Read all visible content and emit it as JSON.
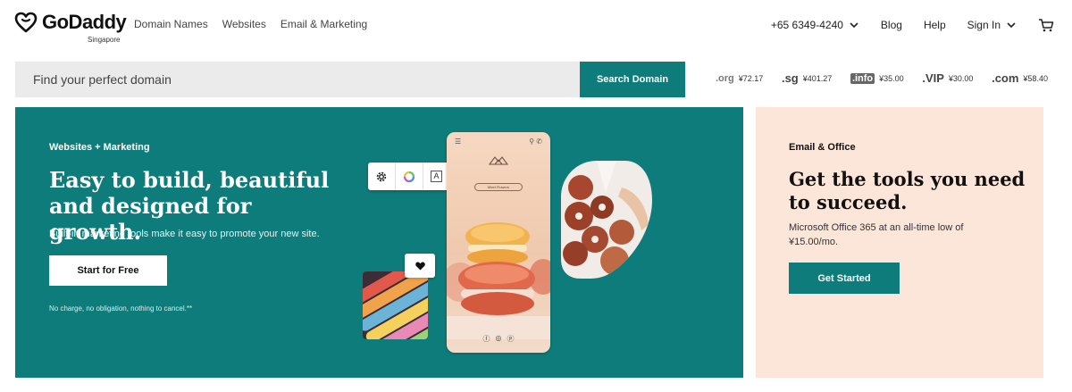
{
  "brand": {
    "name": "GoDaddy",
    "region": "Singapore",
    "logo_icon": "godaddy-logo-icon"
  },
  "nav": {
    "items": [
      "Domain Names",
      "Websites",
      "Email & Marketing"
    ]
  },
  "header_right": {
    "phone": "+65 6349-4240",
    "blog": "Blog",
    "help": "Help",
    "sign_in": "Sign In",
    "cart_icon": "cart-icon",
    "chevron_icon": "chevron-down-icon"
  },
  "search": {
    "placeholder": "Find your perfect domain",
    "button_label": "Search Domain"
  },
  "tlds": [
    {
      "name": ".org",
      "price": "¥72.17"
    },
    {
      "name": ".sg",
      "price": "¥401.27"
    },
    {
      "name": ".info",
      "price": "¥35.00"
    },
    {
      "name": ".VIP",
      "price": "¥30.00"
    },
    {
      "name": ".com",
      "price": "¥58.40"
    }
  ],
  "hero": {
    "eyebrow": "Websites + Marketing",
    "title": "Easy to build, beautiful and designed for growth.",
    "subtitle": "Built-in marketing tools make it easy to promote your new site.",
    "cta": "Start for Free",
    "note": "No charge, no obligation, nothing to cancel.**",
    "phone_button": "Meet Flowers",
    "background_color": "#0e7c7b"
  },
  "promo": {
    "eyebrow": "Email & Office",
    "title": "Get the tools you need to succeed.",
    "subtitle": "Microsoft Office 365 at an all-time low of ¥15.00/mo.",
    "cta": "Get Started",
    "background_color": "#fce6da"
  },
  "colors": {
    "accent": "#0e7c7b",
    "promo_bg": "#fce6da",
    "search_bg": "#ebebeb"
  }
}
